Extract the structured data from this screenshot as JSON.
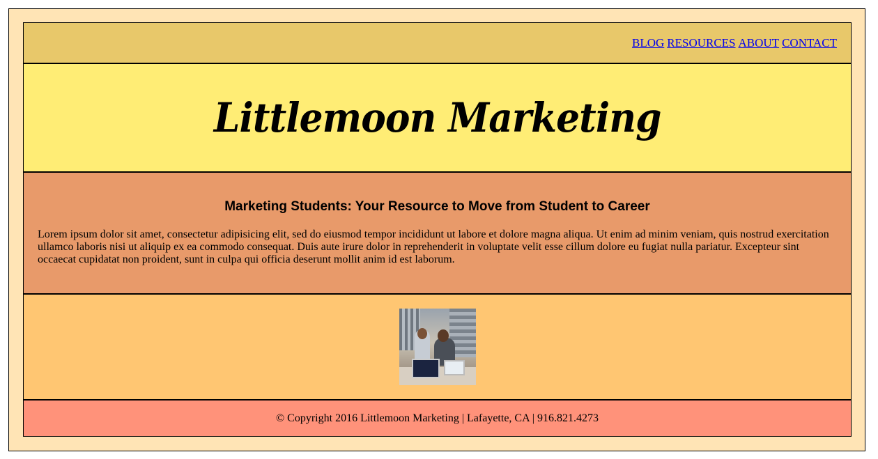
{
  "nav": {
    "items": [
      {
        "label": "BLOG"
      },
      {
        "label": "RESOURCES"
      },
      {
        "label": "ABOUT"
      },
      {
        "label": "CONTACT"
      }
    ]
  },
  "masthead": {
    "title": "Littlemoon Marketing"
  },
  "intro": {
    "heading": "Marketing Students: Your Resource to Move from Student to Career",
    "body": "Lorem ipsum dolor sit amet, consectetur adipisicing elit, sed do eiusmod tempor incididunt ut labore et dolore magna aliqua. Ut enim ad minim veniam, quis nostrud exercitation ullamco laboris nisi ut aliquip ex ea commodo consequat. Duis aute irure dolor in reprehenderit in voluptate velit esse cillum dolore eu fugiat nulla pariatur. Excepteur sint occaecat cupidatat non proident, sunt in culpa qui officia deserunt mollit anim id est laborum."
  },
  "footer": {
    "text": "© Copyright 2016 Littlemoon Marketing | Lafayette, CA | 916.821.4273"
  },
  "colors": {
    "page_bg": "#ffe4b5",
    "nav_bg": "#e8c86a",
    "masthead_bg": "#ffed75",
    "intro_bg": "#e89a6a",
    "photo_band_bg": "#ffc672",
    "footer_bg": "#ff927a",
    "link": "#0000ee"
  }
}
